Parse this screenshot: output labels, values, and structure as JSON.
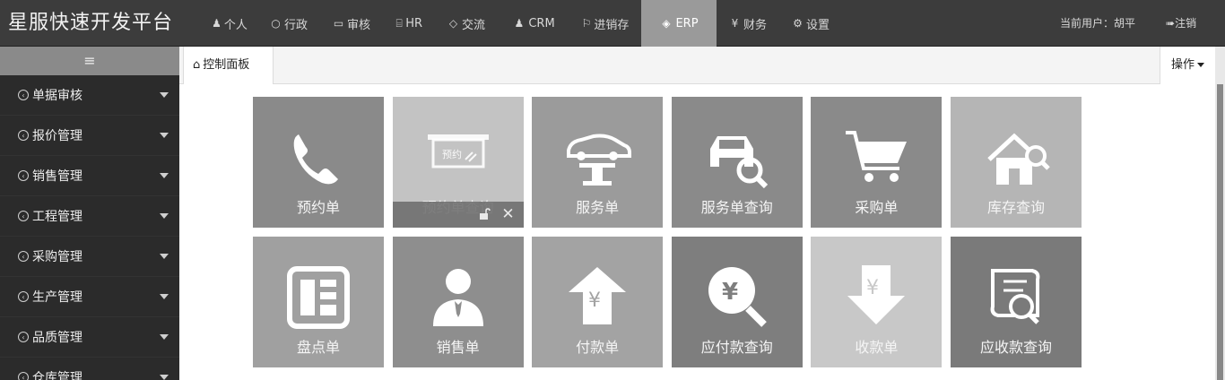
{
  "brand": "星服快速开发平台",
  "nav": [
    {
      "label": "个人",
      "icon": "user-icon",
      "glyph": "♟"
    },
    {
      "label": "行政",
      "icon": "clock-icon",
      "glyph": "○"
    },
    {
      "label": "审核",
      "icon": "folder-icon",
      "glyph": "▭"
    },
    {
      "label": "HR",
      "icon": "book-icon",
      "glyph": "⌸"
    },
    {
      "label": "交流",
      "icon": "chat-icon",
      "glyph": "◇"
    },
    {
      "label": "CRM",
      "icon": "users-icon",
      "glyph": "♟"
    },
    {
      "label": "进销存",
      "icon": "flag-icon",
      "glyph": "⚐"
    },
    {
      "label": "ERP",
      "icon": "cube-icon",
      "glyph": "◈",
      "active": true
    },
    {
      "label": "财务",
      "icon": "yen-circle-icon",
      "glyph": "¥"
    },
    {
      "label": "设置",
      "icon": "gear-icon",
      "glyph": "⚙"
    }
  ],
  "user_info": "当前用户：胡平",
  "logout_label": "注销",
  "sidebar_toggle_glyph": "≡",
  "sidebar": [
    {
      "label": "单据审核"
    },
    {
      "label": "报价管理"
    },
    {
      "label": "销售管理"
    },
    {
      "label": "工程管理"
    },
    {
      "label": "采购管理"
    },
    {
      "label": "生产管理"
    },
    {
      "label": "品质管理"
    },
    {
      "label": "仓库管理"
    }
  ],
  "tab_active_label": "控制面板",
  "ops_label": "操作",
  "tiles": [
    {
      "label": "预约单",
      "icon": "phone-icon",
      "color": "#8a8a8a"
    },
    {
      "label": "预约单查询",
      "icon": "board-icon",
      "color": "#c3c3c3",
      "board_text": "预约",
      "overlay": true
    },
    {
      "label": "服务单",
      "icon": "car-lift-icon",
      "color": "#9b9b9b"
    },
    {
      "label": "服务单查询",
      "icon": "car-search-icon",
      "color": "#8a8a8a"
    },
    {
      "label": "采购单",
      "icon": "cart-icon",
      "color": "#8a8a8a"
    },
    {
      "label": "库存查询",
      "icon": "house-search-icon",
      "color": "#b5b5b5"
    },
    {
      "label": "盘点单",
      "icon": "panel-icon",
      "color": "#a0a0a0"
    },
    {
      "label": "销售单",
      "icon": "person-icon",
      "color": "#8e8e8e"
    },
    {
      "label": "付款单",
      "icon": "upload-yen-icon",
      "color": "#a3a3a3"
    },
    {
      "label": "应付款查询",
      "icon": "yen-search-icon",
      "color": "#7e7e7e"
    },
    {
      "label": "收款单",
      "icon": "download-yen-icon",
      "color": "#c8c8c8"
    },
    {
      "label": "应收款查询",
      "icon": "document-search-icon",
      "color": "#7a7a7a"
    }
  ]
}
